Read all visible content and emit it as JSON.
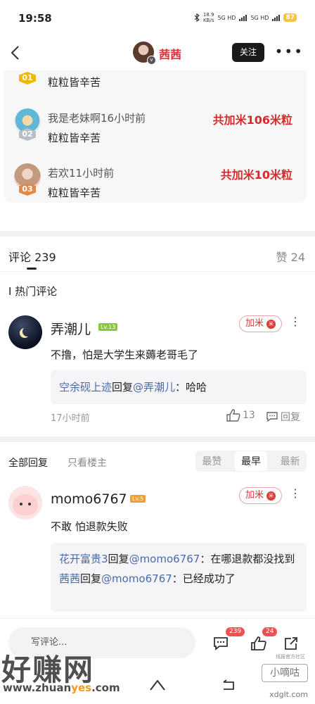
{
  "status_bar": {
    "time": "19:58",
    "net_speed": "18.9",
    "net_unit": "KB/s",
    "network_labels": [
      "5G HD",
      "5G HD"
    ],
    "battery": "87"
  },
  "header": {
    "username": "茜茜",
    "follow_label": "关注",
    "more_icon": "more-dots-icon",
    "back_icon": "chevron-left-icon"
  },
  "donors": [
    {
      "rank": "01",
      "meta": "",
      "message": "粒粒皆辛苦",
      "amount": ""
    },
    {
      "rank": "02",
      "meta": "我是老妹啊16小时前",
      "message": "粒粒皆辛苦",
      "amount": "共加米106米粒"
    },
    {
      "rank": "03",
      "meta": "若欢11小时前",
      "message": "粒粒皆辛苦",
      "amount": "共加米10米粒"
    }
  ],
  "comments_section": {
    "comments_label": "评论",
    "comments_count": "239",
    "likes_label": "赞",
    "likes_count": "24",
    "hot_title": "I 热门评论"
  },
  "hot_comment": {
    "username": "弄潮儿",
    "level": "Lv.13",
    "jiami_label": "加米",
    "text": "不撸，怕是大学生来薅老哥毛了",
    "reply_user": "空余砚上迹",
    "reply_word": "回复",
    "reply_target": "@弄潮儿",
    "reply_text": "：哈哈",
    "time": "17小时前",
    "like_count": "13",
    "reply_label": "回复"
  },
  "reply_filter": {
    "all_replies": "全部回复",
    "only_op": "只看楼主",
    "sort_options": [
      "最赞",
      "最早",
      "最新"
    ],
    "active_sort": "最早"
  },
  "momo_comment": {
    "username": "momo6767",
    "level": "Lv.5",
    "jiami_label": "加米",
    "text": "不敢 怕退款失败",
    "replies": [
      {
        "user": "花开富贵3",
        "word": "回复",
        "target": "@momo6767",
        "text": "：在哪退款都没找到"
      },
      {
        "user": "茜茜",
        "word": "回复",
        "target": "@momo6767",
        "text": "：已经成功了"
      }
    ]
  },
  "bottom_bar": {
    "input_placeholder": "写评论...",
    "comment_count": "239",
    "like_count": "24"
  },
  "watermark": {
    "brand": "好赚网",
    "url_prefix": "www.zhuan",
    "url_highlight": "yes",
    "url_suffix": ".com",
    "small_label": "线报官方社区",
    "box_label": "小嘀咕",
    "url2": "xdglt.com"
  },
  "colors": {
    "accent_red": "#e0303a",
    "link_blue": "#4a6aa8",
    "level_green": "#8cc63f",
    "level_orange": "#f0a030"
  }
}
